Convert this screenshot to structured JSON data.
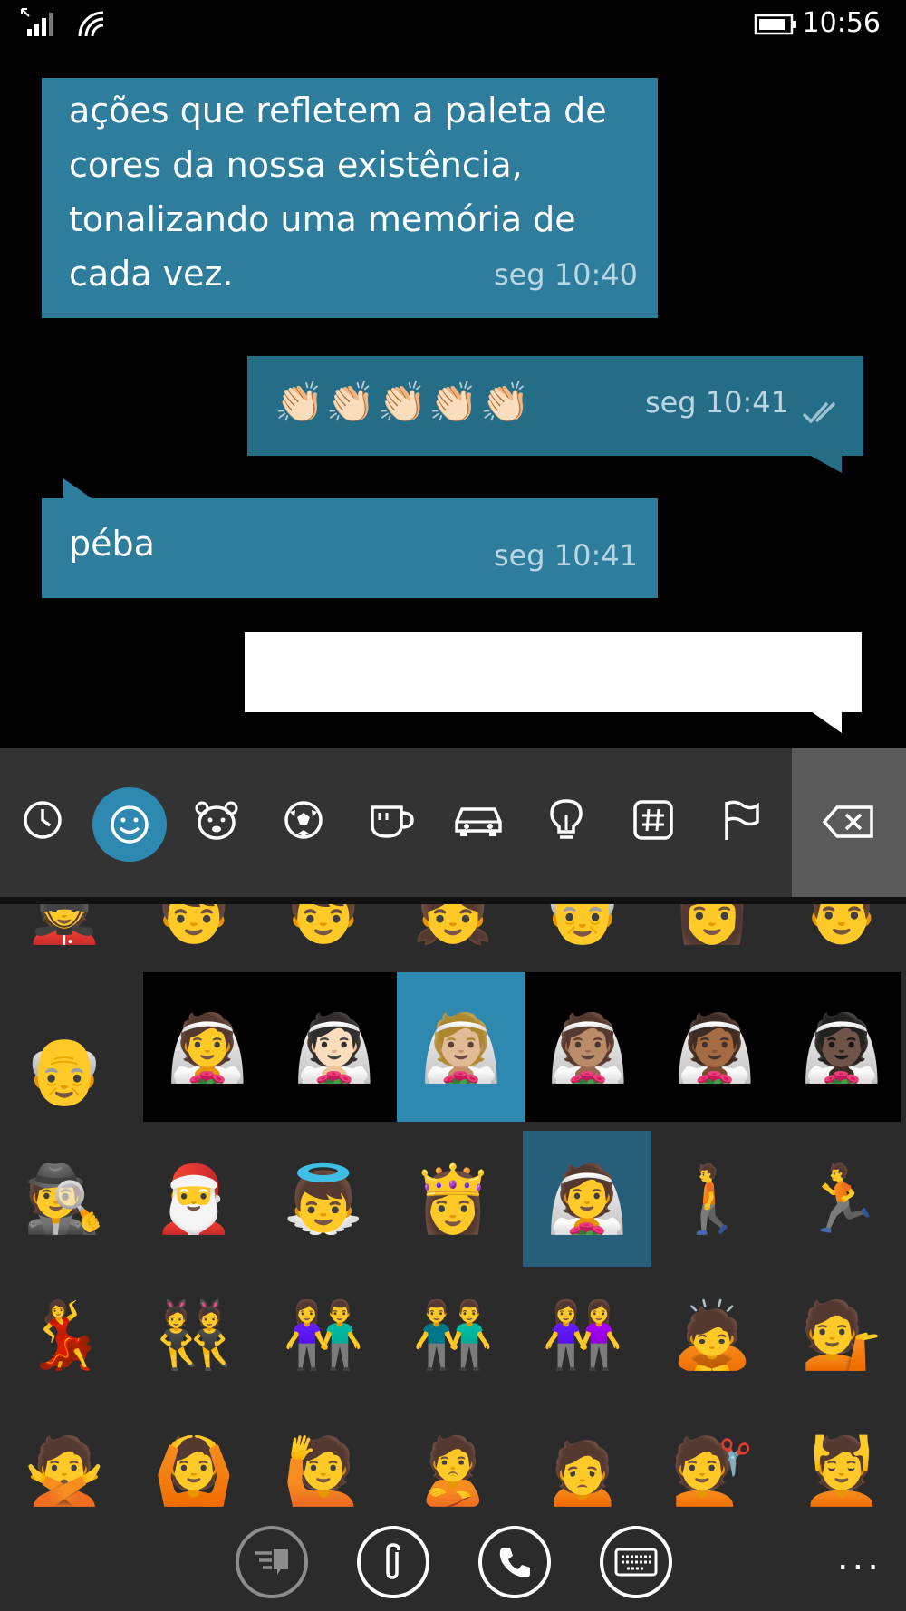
{
  "status": {
    "time": "10:56"
  },
  "messages": [
    {
      "direction": "in",
      "text": "ações que refletem a paleta de cores da nossa existência, tonalizando uma memória de cada vez.",
      "time": "seg 10:40"
    },
    {
      "direction": "out",
      "text": "👏🏻👏🏻👏🏻👏🏻👏🏻",
      "time": "seg 10:41",
      "status": "read"
    },
    {
      "direction": "in",
      "text": "péba",
      "time": "seg 10:41"
    },
    {
      "direction": "out",
      "text": "",
      "time": ""
    }
  ],
  "emoji_categories": [
    {
      "name": "recent",
      "icon": "clock-icon"
    },
    {
      "name": "smileys",
      "icon": "smiley-icon",
      "active": true
    },
    {
      "name": "animals",
      "icon": "bear-icon"
    },
    {
      "name": "activities",
      "icon": "soccer-ball-icon"
    },
    {
      "name": "food",
      "icon": "coffee-cup-icon"
    },
    {
      "name": "travel",
      "icon": "car-icon"
    },
    {
      "name": "objects",
      "icon": "light-bulb-icon"
    },
    {
      "name": "symbols",
      "icon": "hash-icon"
    },
    {
      "name": "flags",
      "icon": "flag-icon"
    }
  ],
  "backspace_icon": "backspace-icon",
  "emoji_grid": {
    "row0": [
      "💂",
      "👦",
      "👦",
      "👧",
      "👴",
      "👩",
      "👨"
    ],
    "row1_first": "👴",
    "skin_tone_popup": [
      "👰",
      "👰🏻",
      "👰🏼",
      "👰🏽",
      "👰🏾",
      "👰🏿"
    ],
    "row2": [
      "🕵️",
      "🎅",
      "👼",
      "👸",
      "👰",
      "🚶",
      "🏃"
    ],
    "row3": [
      "💃",
      "👯",
      "👫",
      "👬",
      "👭",
      "🙇",
      "💁"
    ],
    "row4": [
      "🙅",
      "🙆",
      "🙋",
      "🙎",
      "🙍",
      "💇",
      "💆"
    ]
  },
  "appbar": [
    {
      "name": "quick-reply-button",
      "icon": "quick-reply-icon"
    },
    {
      "name": "attach-button",
      "icon": "paperclip-icon"
    },
    {
      "name": "call-button",
      "icon": "phone-icon"
    },
    {
      "name": "keyboard-button",
      "icon": "keyboard-icon"
    }
  ],
  "more_label": "..."
}
